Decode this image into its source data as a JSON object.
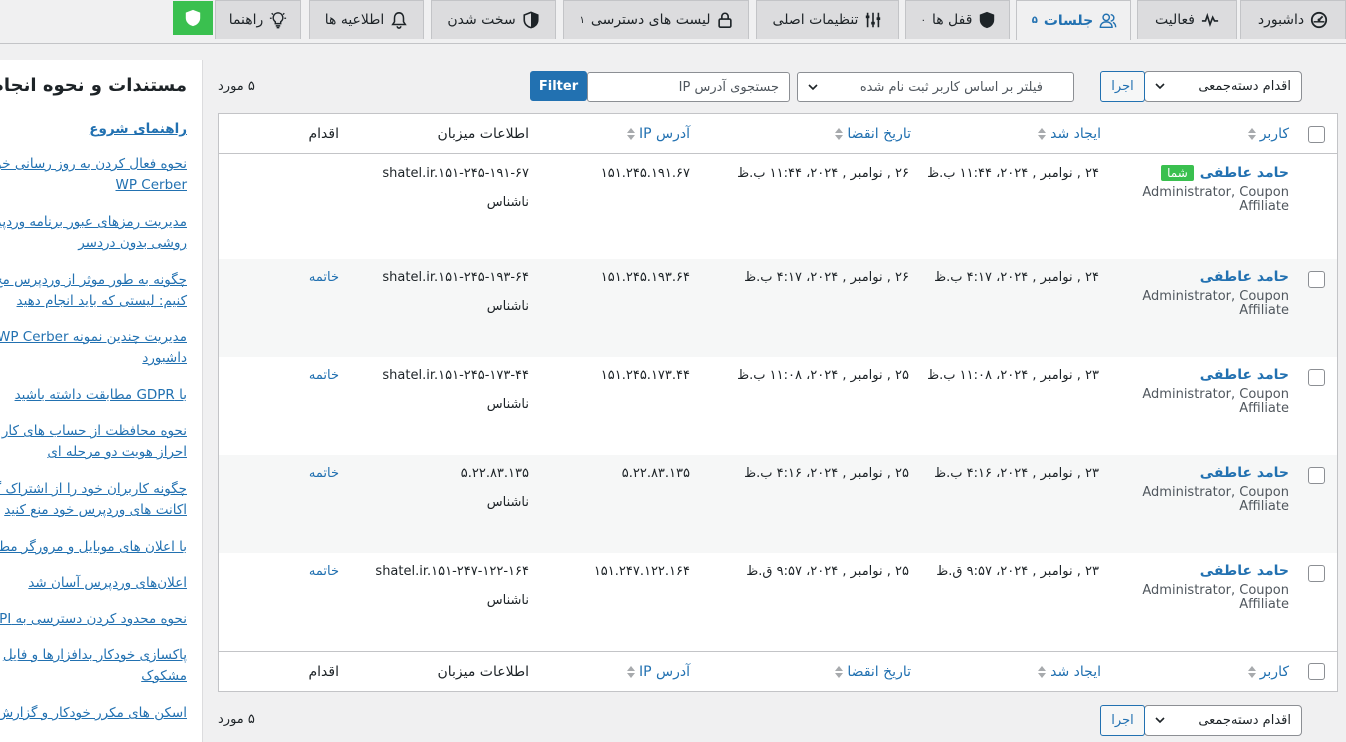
{
  "tabs": [
    {
      "label": "داشبورد",
      "icon": "dashboard-icon",
      "badge": ""
    },
    {
      "label": "فعالیت",
      "icon": "activity-icon",
      "badge": ""
    },
    {
      "label": "جلسات",
      "icon": "users-icon",
      "badge": "۵",
      "active": true
    },
    {
      "label": "قفل ها",
      "icon": "shield-icon",
      "badge": "۰"
    },
    {
      "label": "تنظیمات اصلی",
      "icon": "sliders-icon",
      "badge": ""
    },
    {
      "label": "لیست های دسترسی",
      "icon": "lock-icon",
      "badge": "۱"
    },
    {
      "label": "سخت شدن",
      "icon": "shield-outline-icon",
      "badge": ""
    },
    {
      "label": "اطلاعیه ها",
      "icon": "bell-icon",
      "badge": ""
    },
    {
      "label": "راهنما",
      "icon": "lightbulb-icon",
      "badge": ""
    }
  ],
  "colors": {
    "accent": "#2271b1",
    "green": "#3ac04f"
  },
  "toolbar": {
    "bulk_action": "اقدام دسته‌جمعی",
    "apply_label": "اجرا",
    "user_filter_placeholder": "فیلتر بر اساس کاربر ثبت نام شده",
    "ip_search_placeholder": "جستجوی آدرس IP",
    "filter_label": "Filter",
    "items_count": "۵ مورد"
  },
  "table": {
    "headers": {
      "user": "کاربر",
      "created": "ایجاد شد",
      "expires": "تاریخ انقضا",
      "ip": "آدرس IP",
      "host": "اطلاعات میزبان",
      "action": "اقدام"
    },
    "you_badge": "شما",
    "rows": [
      {
        "user": "حامد عاطفی",
        "is_you": true,
        "roles1": "Administrator, Coupon",
        "roles2": "Affiliate",
        "created": "۲۴ , نوامبر , ۲۰۲۴، ۱۱:۴۴ ب.ظ",
        "expires": "۲۶ , نوامبر , ۲۰۲۴، ۱۱:۴۴ ب.ظ",
        "ip": "۱۵۱.۲۴۵.۱۹۱.۶۷",
        "host": "shatel.ir.۱۵۱-۲۴۵-۱۹۱-۶۷",
        "host_country": "ناشناس",
        "action": ""
      },
      {
        "user": "حامد عاطفی",
        "is_you": false,
        "roles1": "Administrator, Coupon",
        "roles2": "Affiliate",
        "created": "۲۴ , نوامبر , ۲۰۲۴، ۴:۱۷ ب.ظ",
        "expires": "۲۶ , نوامبر , ۲۰۲۴، ۴:۱۷ ب.ظ",
        "ip": "۱۵۱.۲۴۵.۱۹۳.۶۴",
        "host": "shatel.ir.۱۵۱-۲۴۵-۱۹۳-۶۴",
        "host_country": "ناشناس",
        "action": "خاتمه"
      },
      {
        "user": "حامد عاطفی",
        "is_you": false,
        "roles1": "Administrator, Coupon",
        "roles2": "Affiliate",
        "created": "۲۳ , نوامبر , ۲۰۲۴، ۱۱:۰۸ ب.ظ",
        "expires": "۲۵ , نوامبر , ۲۰۲۴، ۱۱:۰۸ ب.ظ",
        "ip": "۱۵۱.۲۴۵.۱۷۳.۴۴",
        "host": "shatel.ir.۱۵۱-۲۴۵-۱۷۳-۴۴",
        "host_country": "ناشناس",
        "action": "خاتمه"
      },
      {
        "user": "حامد عاطفی",
        "is_you": false,
        "roles1": "Administrator, Coupon",
        "roles2": "Affiliate",
        "created": "۲۳ , نوامبر , ۲۰۲۴، ۴:۱۶ ب.ظ",
        "expires": "۲۵ , نوامبر , ۲۰۲۴، ۴:۱۶ ب.ظ",
        "ip": "۵.۲۲.۸۳.۱۳۵",
        "host": "۵.۲۲.۸۳.۱۳۵",
        "host_country": "ناشناس",
        "action": "خاتمه"
      },
      {
        "user": "حامد عاطفی",
        "is_you": false,
        "roles1": "Administrator, Coupon",
        "roles2": "Affiliate",
        "created": "۲۳ , نوامبر , ۲۰۲۴، ۹:۵۷ ق.ظ",
        "expires": "۲۵ , نوامبر , ۲۰۲۴، ۹:۵۷ ق.ظ",
        "ip": "۱۵۱.۲۴۷.۱۲۲.۱۶۴",
        "host": "shatel.ir.۱۵۱-۲۴۷-۱۲۲-۱۶۴",
        "host_country": "ناشناس",
        "action": "خاتمه"
      }
    ]
  },
  "sidebar": {
    "title": "مستندات و نحوه انجام",
    "links": [
      {
        "text": "راهنمای شروع",
        "bold": true
      },
      {
        "text": "نحوه فعال کردن به روز رسانی خود",
        "text2": "WP Cerber"
      },
      {
        "text": "مدیریت رمزهای عبور برنامه وردپر",
        "text2": "روشی بدون دردسر"
      },
      {
        "text": "چگونه به طور موثر از وردپرس مح",
        "text2": "کنیم: لیستی که باید انجام دهید"
      },
      {
        "text": "مدیریت چندین نمونه WP Cerber",
        "text2": "داشبورد"
      },
      {
        "text": "با GDPR مطابقت داشته باشید"
      },
      {
        "text": "نحوه محافظت از حساب های کار",
        "text2": "احراز هویت دو مرحله ای"
      },
      {
        "text": "چگونه کاربران خود را از اشتراک گ",
        "text2": "اکانت های وردپرس خود منع کنید"
      },
      {
        "text": "با اعلان های موبایل و مرورگر مطل"
      },
      {
        "text": "اعلان‌های وردپرس آسان شد"
      },
      {
        "text": "نحوه محدود کردن دسترسی به PI"
      },
      {
        "text": "پاکسازی خودکار بدافزارها و فایل",
        "text2": "مشکوک"
      },
      {
        "text": "اسکن های مکرر خودکار و گزارش"
      }
    ]
  }
}
